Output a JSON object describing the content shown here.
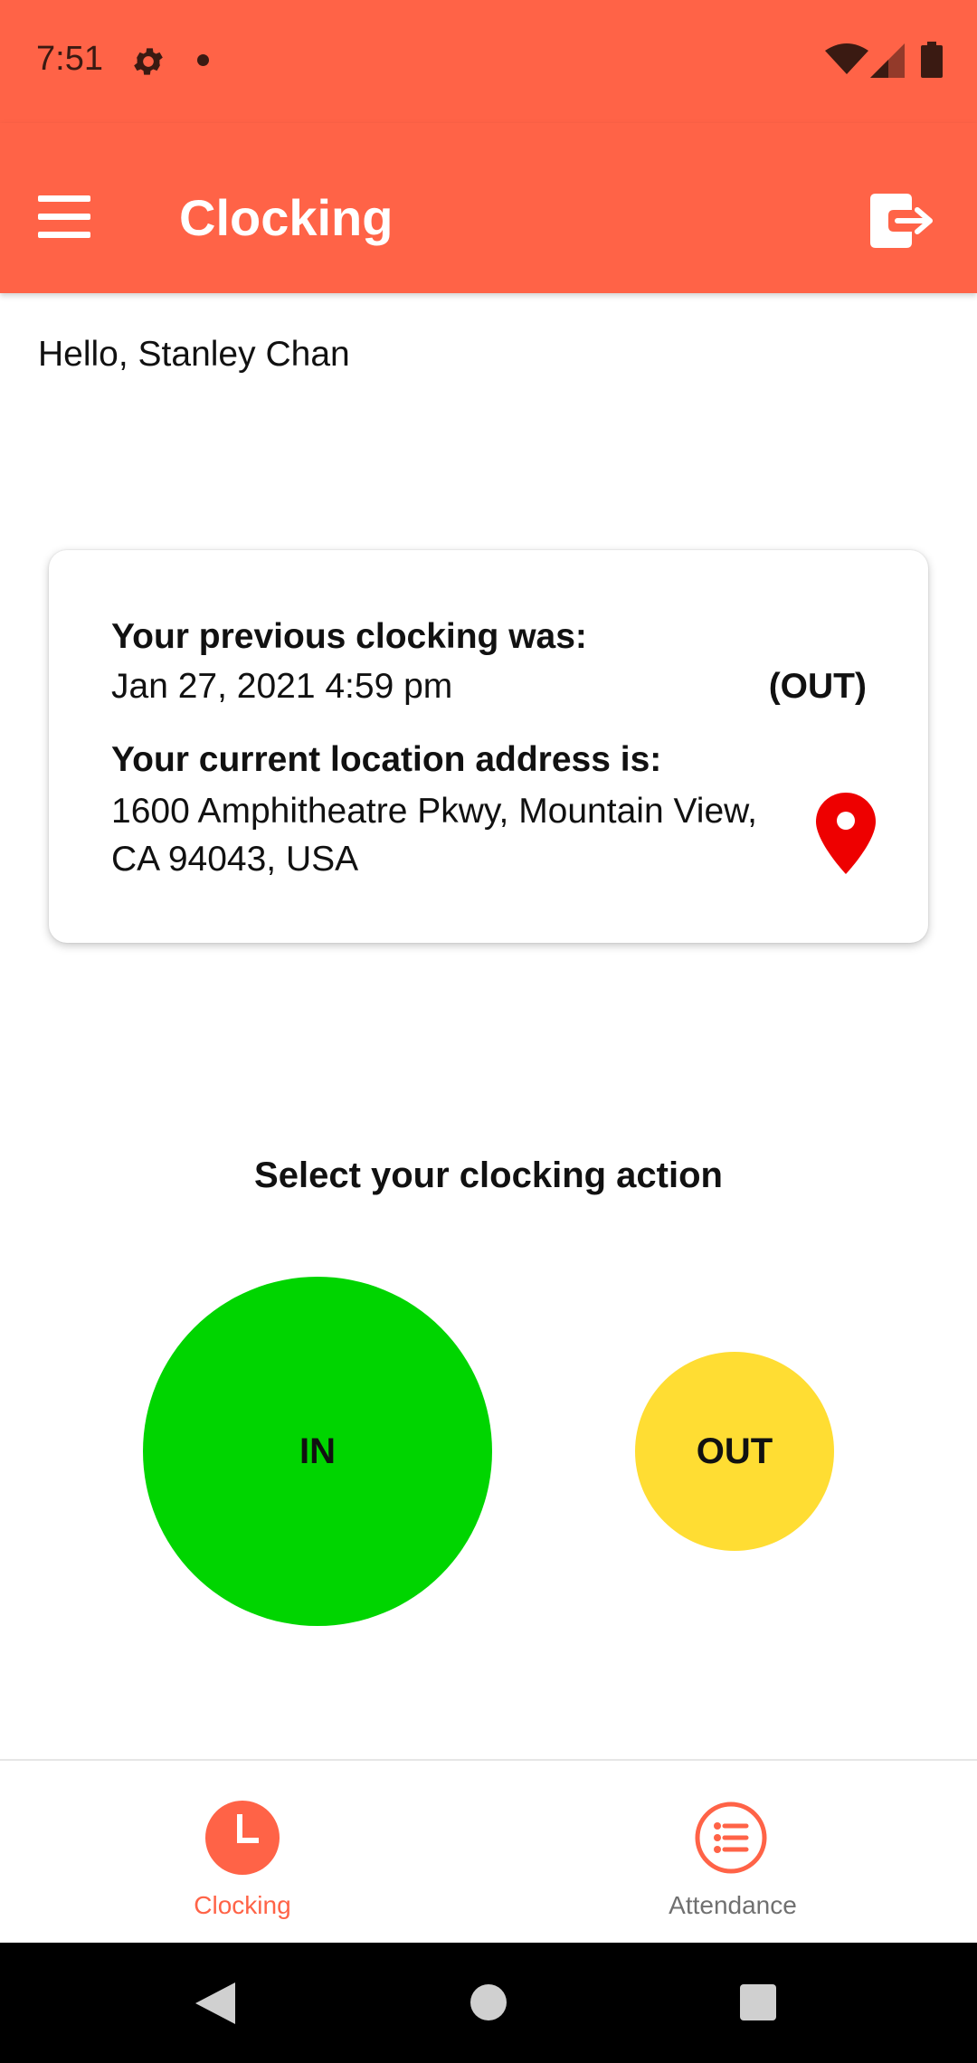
{
  "status_bar": {
    "time": "7:51",
    "icons": [
      "gear-icon",
      "notification-dot",
      "wifi-icon",
      "signal-icon",
      "battery-icon"
    ]
  },
  "app_bar": {
    "title": "Clocking",
    "menu_icon": "menu-icon",
    "logout_icon": "logout-icon",
    "color": "#ff6347"
  },
  "greeting": "Hello, Stanley Chan",
  "card": {
    "previous_label": "Your previous clocking was:",
    "previous_datetime": "Jan 27, 2021 4:59 pm",
    "previous_type": "(OUT)",
    "location_label": "Your current location address is:",
    "location_address": "1600 Amphitheatre Pkwy, Mountain View, CA 94043, USA",
    "location_icon": "map-pin-icon",
    "location_icon_color": "#ee0000"
  },
  "action": {
    "title": "Select your clocking action",
    "in_label": "IN",
    "out_label": "OUT",
    "in_color": "#00d500",
    "out_color": "#ffdd33"
  },
  "bottom_nav": {
    "items": [
      {
        "label": "Clocking",
        "icon": "clock-icon",
        "active": true
      },
      {
        "label": "Attendance",
        "icon": "list-icon",
        "active": false
      }
    ],
    "active_color": "#ff6347",
    "inactive_color": "#707070"
  },
  "system_nav": [
    "back-icon",
    "home-icon",
    "recents-icon"
  ]
}
